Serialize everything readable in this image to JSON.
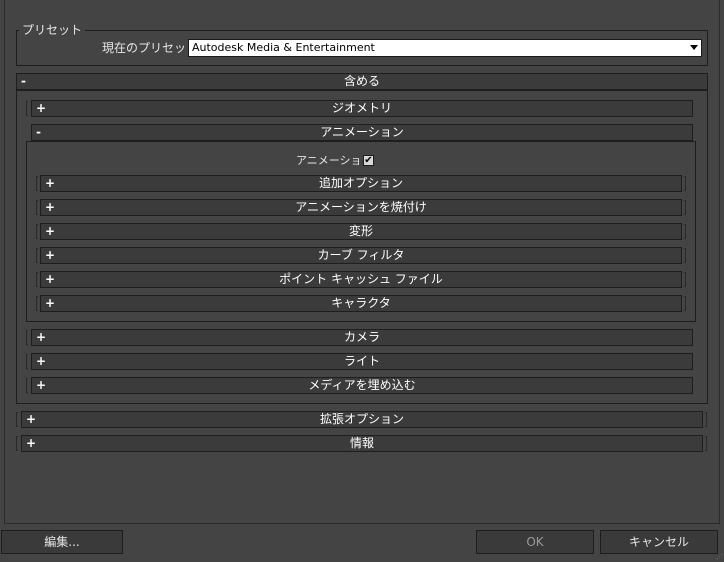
{
  "preset_group": {
    "title": "プリセット",
    "current_label": "現在のプリセット:",
    "current_value": "Autodesk Media & Entertainment"
  },
  "include": {
    "sign": "-",
    "label": "含める"
  },
  "geometry": {
    "sign": "+",
    "label": "ジオメトリ"
  },
  "animation": {
    "sign": "-",
    "label": "アニメーション",
    "checkbox_label": "アニメーション",
    "checkbox_checked": true,
    "check_mark": "✔",
    "subitems": [
      {
        "sign": "+",
        "label": "追加オプション"
      },
      {
        "sign": "+",
        "label": "アニメーションを焼付け"
      },
      {
        "sign": "+",
        "label": "変形"
      },
      {
        "sign": "+",
        "label": "カーブ フィルタ"
      },
      {
        "sign": "+",
        "label": "ポイント キャッシュ ファイル"
      },
      {
        "sign": "+",
        "label": "キャラクタ"
      }
    ]
  },
  "camera": {
    "sign": "+",
    "label": "カメラ"
  },
  "light": {
    "sign": "+",
    "label": "ライト"
  },
  "embed_media": {
    "sign": "+",
    "label": "メディアを埋め込む"
  },
  "advanced": {
    "sign": "+",
    "label": "拡張オプション"
  },
  "info": {
    "sign": "+",
    "label": "情報"
  },
  "buttons": {
    "edit": "編集...",
    "ok": "OK",
    "cancel": "キャンセル"
  }
}
